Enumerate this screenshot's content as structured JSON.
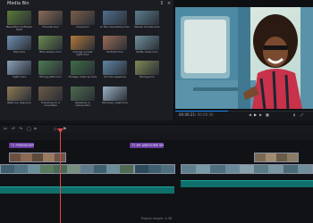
{
  "media_bin": {
    "title": "Media Bin",
    "items": [
      {
        "label": "Beautiful sunflower field",
        "color": "#5b7a3a"
      },
      {
        "label": "Friends.mov",
        "color": "#8a6a55"
      },
      {
        "label": "Cozy.mov",
        "color": "#7a5d4a"
      },
      {
        "label": "In the mountains.mov",
        "color": "#4f6e8c"
      },
      {
        "label": "Waves Smoke.mov",
        "color": "#5b7e8e"
      },
      {
        "label": "Kite.mov",
        "color": "#6f8fb0"
      },
      {
        "label": "Bike lesson.mov",
        "color": "#6b8a4e"
      },
      {
        "label": "Orange sunset light.mov",
        "color": "#b0763a"
      },
      {
        "label": "Portrait.mov",
        "color": "#9a6a55"
      },
      {
        "label": "Selfie vibes.mov",
        "color": "#6e8f9c"
      },
      {
        "label": "Sight.mov",
        "color": "#8ba0b8"
      },
      {
        "label": "Hiking path.mov",
        "color": "#4f7a52"
      },
      {
        "label": "Foliage close up.mov",
        "color": "#3e6e45"
      },
      {
        "label": "On the seashore",
        "color": "#5f86a5"
      },
      {
        "label": "Hiking.mov",
        "color": "#7d8a55"
      },
      {
        "label": "Walk my dog.mov",
        "color": "#8f7a55"
      },
      {
        "label": "Traveling on a mountain",
        "color": "#6a5a45"
      },
      {
        "label": "Relaxing in nature.mov",
        "color": "#4e6a4f"
      },
      {
        "label": "Morning coast.mov",
        "color": "#9ab0c4"
      }
    ]
  },
  "preview": {
    "current_time": "00:00:21",
    "duration": "/ 00:00:56",
    "progress": 0.38
  },
  "timeline": {
    "title_clips": [
      {
        "label": "T1 FRIENDSHIP"
      },
      {
        "label": "T2 MY AWESOME SELFIE"
      }
    ],
    "project_length": "Project length: 4:38"
  },
  "colors": {
    "accent": "#1f8fff",
    "title_track": "#6a3fa3",
    "audio_track": "#0f6f6a",
    "playhead": "#e04848"
  }
}
